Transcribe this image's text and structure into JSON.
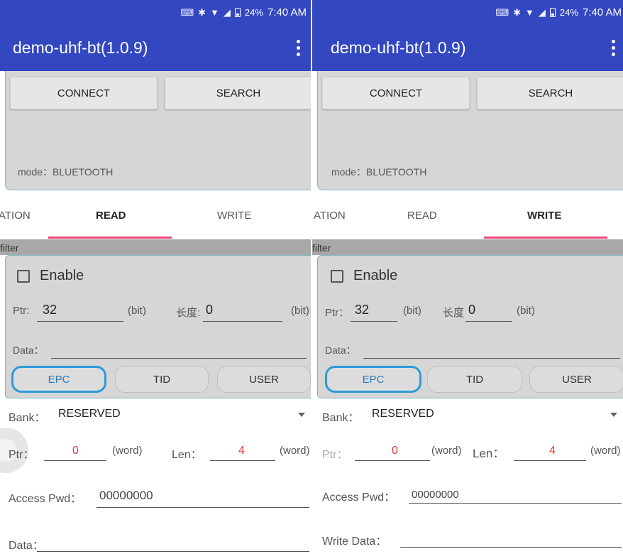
{
  "status": {
    "battery": "24%",
    "time": "7:40 AM"
  },
  "app": {
    "title": "demo-uhf-bt(1.0.9)"
  },
  "connection": {
    "connect_label": "CONNECT",
    "search_label": "SEARCH",
    "mode_text": "mode：BLUETOOTH"
  },
  "tabs": [
    {
      "label": "ATION"
    },
    {
      "label": "READ"
    },
    {
      "label": "WRITE"
    }
  ],
  "filter": {
    "strip_label": "filter",
    "enable_label": "Enable",
    "enabled": false,
    "ptr_label": "Ptr:",
    "ptr_label_right": "Ptr：",
    "ptr_value": "32",
    "bit_label": "(bit)",
    "len_label": "长度:",
    "len_label_right": "长度",
    "len_value": "0",
    "data_label": "Data：",
    "banks": [
      "EPC",
      "TID",
      "USER"
    ],
    "active_bank": "EPC"
  },
  "read_form": {
    "bank_label": "Bank：",
    "bank_value": "RESERVED",
    "ptr_label": "Ptr：",
    "ptr_value": "0",
    "word_label": "(word)",
    "len_label": "Len：",
    "len_value": "4",
    "pwd_label": "Access Pwd：",
    "pwd_value": "00000000",
    "data_label": "Data："
  },
  "write_form": {
    "bank_label": "Bank：",
    "bank_value": "RESERVED",
    "ptr_label": "Ptr：",
    "ptr_value": "0",
    "word_label": "(word)",
    "len_label": "Len：",
    "len_value": "4",
    "pwd_label": "Access Pwd：",
    "pwd_value": "00000000",
    "data_label": "Write Data："
  },
  "colors": {
    "appbar": "#3347c0",
    "tab_indicator": "#ee4a78",
    "active_bank_border": "#2c9ad8",
    "value_red": "#e53935"
  }
}
